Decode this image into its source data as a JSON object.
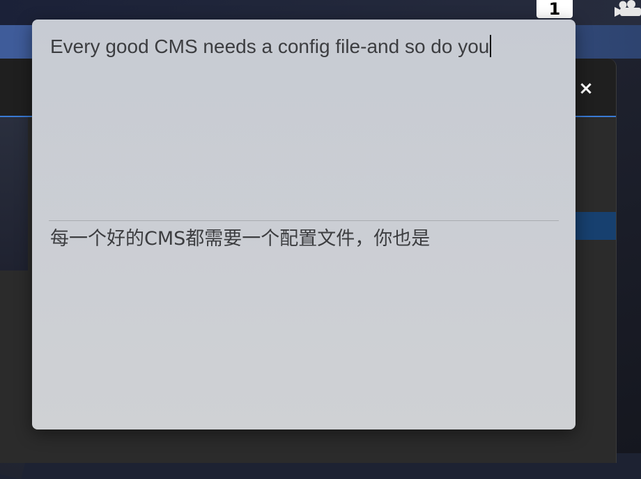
{
  "topbar": {
    "badge_number": "1"
  },
  "back_window": {
    "close_glyph": "×"
  },
  "popup": {
    "source_text": "Every good CMS needs a config file-and so do you",
    "translated_text": "每一个好的CMS都需要一个配置文件，你也是"
  },
  "icons": {
    "close": "close-icon",
    "camera": "camera-icon"
  },
  "colors": {
    "accent_blue": "#3a7bd5",
    "popup_bg": "#cbced4",
    "text": "#3c3d40"
  }
}
